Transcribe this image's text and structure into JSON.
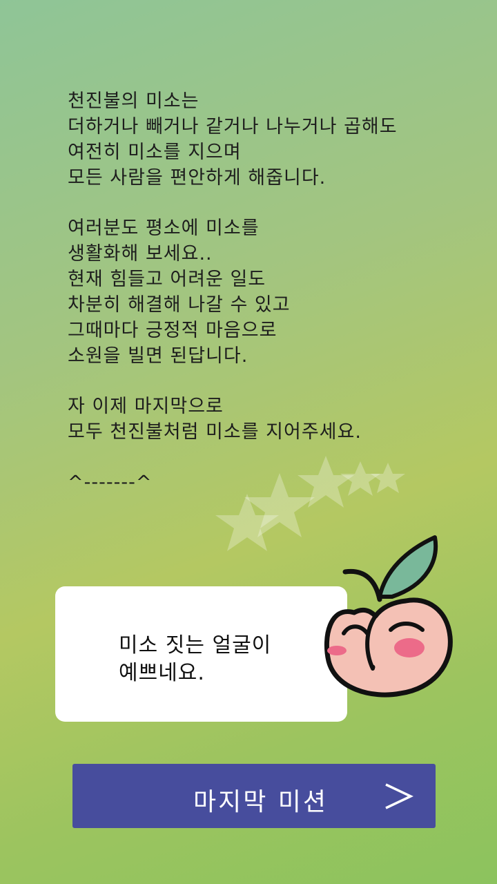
{
  "message": {
    "paragraphs": [
      {
        "lines": [
          "천진불의 미소는",
          "더하거나 빼거나 같거나 나누거나 곱해도",
          "여전히 미소를 지으며",
          "모든 사람을 편안하게 해줍니다."
        ]
      },
      {
        "lines": [
          "여러분도 평소에 미소를",
          "생활화해 보세요..",
          "현재 힘들고 어려운 일도",
          "차분히 해결해 나갈 수 있고",
          "그때마다 긍정적 마음으로",
          "소원을 빌면 된답니다."
        ]
      },
      {
        "lines": [
          "자 이제 마지막으로",
          "모두 천진불처럼 미소를 지어주세요."
        ]
      },
      {
        "lines": [
          "^-------^"
        ]
      }
    ]
  },
  "speech": {
    "lines": [
      "미소 짓는 얼굴이",
      "예쁘네요."
    ]
  },
  "button": {
    "label": "마지막 미션",
    "icon": "chevron-right-icon"
  },
  "colors": {
    "button": "#474d9d",
    "leaf": "#79b89a",
    "peach": "#f4c1b5",
    "cheek": "#ec6b89"
  }
}
